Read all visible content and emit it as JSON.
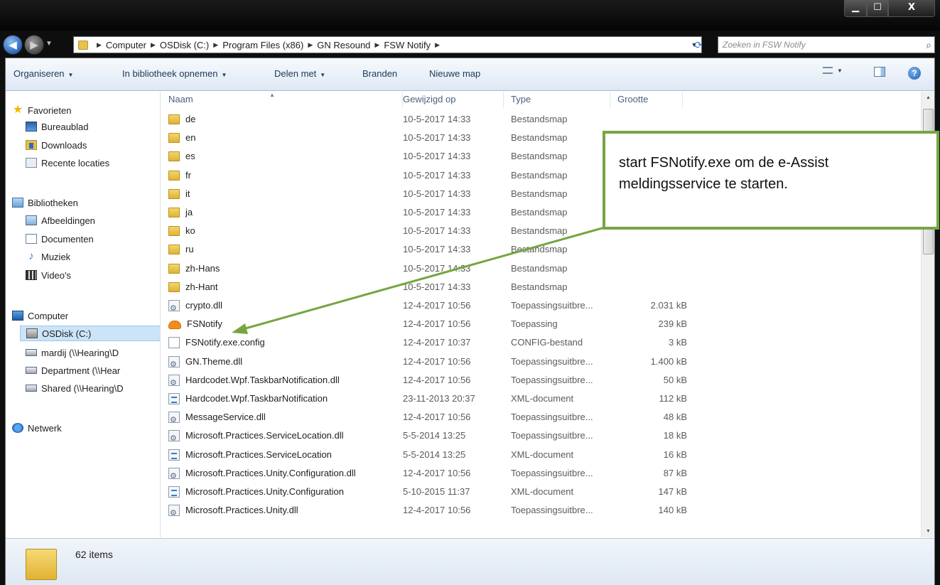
{
  "window": {
    "controls": {
      "minimize": "▁",
      "maximize": "☐",
      "close": "X"
    }
  },
  "address": {
    "crumbs": [
      "Computer",
      "OSDisk (C:)",
      "Program Files (x86)",
      "GN Resound",
      "FSW Notify"
    ],
    "search_placeholder": "Zoeken in FSW Notify"
  },
  "toolbar": {
    "organize": "Organiseren",
    "include_library": "In bibliotheek opnemen",
    "share": "Delen met",
    "burn": "Branden",
    "new_folder": "Nieuwe map"
  },
  "nav": {
    "favorites": "Favorieten",
    "desktop": "Bureaublad",
    "downloads": "Downloads",
    "recent": "Recente locaties",
    "libraries": "Bibliotheken",
    "pictures": "Afbeeldingen",
    "documents": "Documenten",
    "music": "Muziek",
    "videos": "Video's",
    "computer": "Computer",
    "osdisk": "OSDisk (C:)",
    "drive_mardij": "mardij (\\\\Hearing\\D",
    "drive_department": "Department (\\\\Hear",
    "drive_shared": "Shared (\\\\Hearing\\D",
    "network": "Netwerk"
  },
  "columns": {
    "name": "Naam",
    "modified": "Gewijzigd op",
    "type": "Type",
    "size": "Grootte"
  },
  "files": [
    {
      "name": "de",
      "date": "10-5-2017 14:33",
      "type": "Bestandsmap",
      "size": "",
      "icon": "folder"
    },
    {
      "name": "en",
      "date": "10-5-2017 14:33",
      "type": "Bestandsmap",
      "size": "",
      "icon": "folder"
    },
    {
      "name": "es",
      "date": "10-5-2017 14:33",
      "type": "Bestandsmap",
      "size": "",
      "icon": "folder"
    },
    {
      "name": "fr",
      "date": "10-5-2017 14:33",
      "type": "Bestandsmap",
      "size": "",
      "icon": "folder"
    },
    {
      "name": "it",
      "date": "10-5-2017 14:33",
      "type": "Bestandsmap",
      "size": "",
      "icon": "folder"
    },
    {
      "name": "ja",
      "date": "10-5-2017 14:33",
      "type": "Bestandsmap",
      "size": "",
      "icon": "folder"
    },
    {
      "name": "ko",
      "date": "10-5-2017 14:33",
      "type": "Bestandsmap",
      "size": "",
      "icon": "folder"
    },
    {
      "name": "ru",
      "date": "10-5-2017 14:33",
      "type": "Bestandsmap",
      "size": "",
      "icon": "folder"
    },
    {
      "name": "zh-Hans",
      "date": "10-5-2017 14:33",
      "type": "Bestandsmap",
      "size": "",
      "icon": "folder"
    },
    {
      "name": "zh-Hant",
      "date": "10-5-2017 14:33",
      "type": "Bestandsmap",
      "size": "",
      "icon": "folder"
    },
    {
      "name": "crypto.dll",
      "date": "12-4-2017 10:56",
      "type": "Toepassingsuitbre...",
      "size": "2.031 kB",
      "icon": "dll"
    },
    {
      "name": "FSNotify",
      "date": "12-4-2017 10:56",
      "type": "Toepassing",
      "size": "239 kB",
      "icon": "app"
    },
    {
      "name": "FSNotify.exe.config",
      "date": "12-4-2017 10:37",
      "type": "CONFIG-bestand",
      "size": "3 kB",
      "icon": "config"
    },
    {
      "name": "GN.Theme.dll",
      "date": "12-4-2017 10:56",
      "type": "Toepassingsuitbre...",
      "size": "1.400 kB",
      "icon": "dll"
    },
    {
      "name": "Hardcodet.Wpf.TaskbarNotification.dll",
      "date": "12-4-2017 10:56",
      "type": "Toepassingsuitbre...",
      "size": "50 kB",
      "icon": "dll"
    },
    {
      "name": "Hardcodet.Wpf.TaskbarNotification",
      "date": "23-11-2013 20:37",
      "type": "XML-document",
      "size": "112 kB",
      "icon": "xml"
    },
    {
      "name": "MessageService.dll",
      "date": "12-4-2017 10:56",
      "type": "Toepassingsuitbre...",
      "size": "48 kB",
      "icon": "dll"
    },
    {
      "name": "Microsoft.Practices.ServiceLocation.dll",
      "date": "5-5-2014 13:25",
      "type": "Toepassingsuitbre...",
      "size": "18 kB",
      "icon": "dll"
    },
    {
      "name": "Microsoft.Practices.ServiceLocation",
      "date": "5-5-2014 13:25",
      "type": "XML-document",
      "size": "16 kB",
      "icon": "xml"
    },
    {
      "name": "Microsoft.Practices.Unity.Configuration.dll",
      "date": "12-4-2017 10:56",
      "type": "Toepassingsuitbre...",
      "size": "87 kB",
      "icon": "dll"
    },
    {
      "name": "Microsoft.Practices.Unity.Configuration",
      "date": "5-10-2015 11:37",
      "type": "XML-document",
      "size": "147 kB",
      "icon": "xml"
    },
    {
      "name": "Microsoft.Practices.Unity.dll",
      "date": "12-4-2017 10:56",
      "type": "Toepassingsuitbre...",
      "size": "140 kB",
      "icon": "dll"
    }
  ],
  "details": {
    "count": "62 items"
  },
  "callout": {
    "line1": "start FSNotify.exe om de e-Assist",
    "line2": "meldingsservice te starten.",
    "border_color": "#76a541"
  }
}
